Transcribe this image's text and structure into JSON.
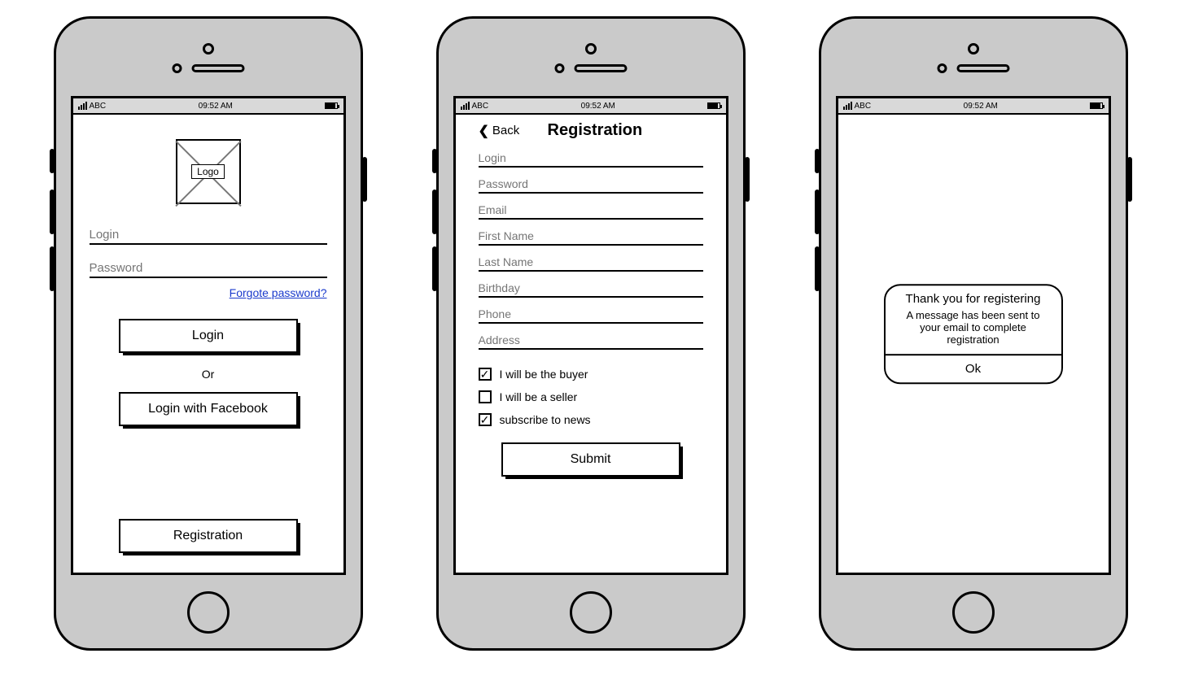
{
  "statusbar": {
    "carrier": "ABC",
    "time": "09:52 AM"
  },
  "screen1": {
    "logo_label": "Logo",
    "login_label": "Login",
    "password_label": "Password",
    "forgot_link": "Forgote password?",
    "login_btn": "Login",
    "or_text": "Or",
    "fb_btn": "Login with Facebook",
    "reg_btn": "Registration"
  },
  "screen2": {
    "back_label": "Back",
    "title": "Registration",
    "fields": {
      "login": "Login",
      "password": "Password",
      "email": "Email",
      "first_name": "First Name",
      "last_name": "Last Name",
      "birthday": "Birthday",
      "phone": "Phone",
      "address": "Address"
    },
    "checks": {
      "buyer": {
        "label": "I will be the buyer",
        "checked": true
      },
      "seller": {
        "label": "I will be a seller",
        "checked": false
      },
      "news": {
        "label": "subscribe to news",
        "checked": true
      }
    },
    "submit_btn": "Submit"
  },
  "screen3": {
    "dialog_title": "Thank you for registering",
    "dialog_msg": "A message has been sent to your email to complete registration",
    "dialog_ok": "Ok"
  }
}
